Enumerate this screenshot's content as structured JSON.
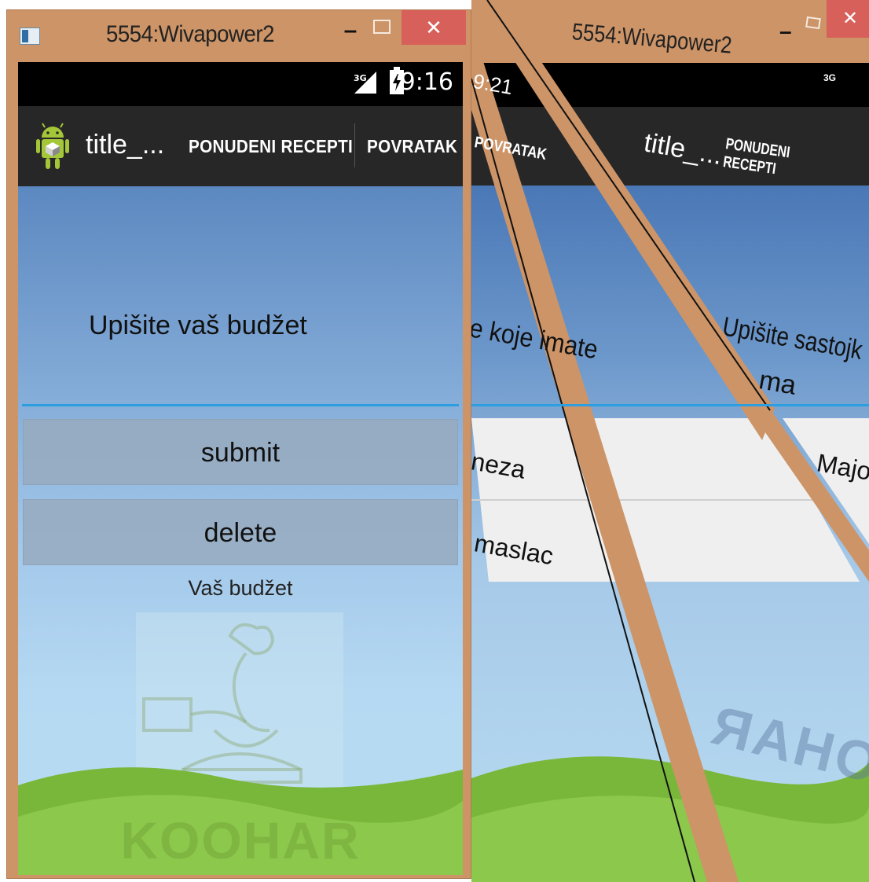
{
  "window": {
    "title": "5554:Wivapower2",
    "minimize_glyph": "–",
    "close_glyph": "✕"
  },
  "status_bar": {
    "network": "3G",
    "time": "9:16"
  },
  "action_bar": {
    "app_title": "title_...",
    "actions": [
      "PONUDENI RECEPTI",
      "POVRATAK"
    ]
  },
  "budget_form": {
    "prompt": "Upišite vaš budžet",
    "input_value": "",
    "submit_label": "submit",
    "delete_label": "delete",
    "result_label": "Vaš budžet"
  },
  "branding": {
    "logo_text": "KOOHAR"
  },
  "second_window": {
    "title": "5554:Wivapower2",
    "status_time": "9:21",
    "network": "3G",
    "action_left": "POVRATAK",
    "app_title": "title_...",
    "action_right": "PONUDENI RECEPTI",
    "prompt_left_fragment": "e koje imate",
    "prompt_right_fragment": "Upišite sastojk",
    "typed_value": "ma",
    "dropdown_items": [
      "neza",
      "maslac",
      "Majo"
    ],
    "logo_text": "KOOHAR"
  },
  "colors": {
    "window_frame": "#cd9467",
    "close_button": "#d8605a",
    "action_bar": "#272727",
    "input_underline": "#2d9fe0",
    "button_fill": "#9aabbd"
  }
}
